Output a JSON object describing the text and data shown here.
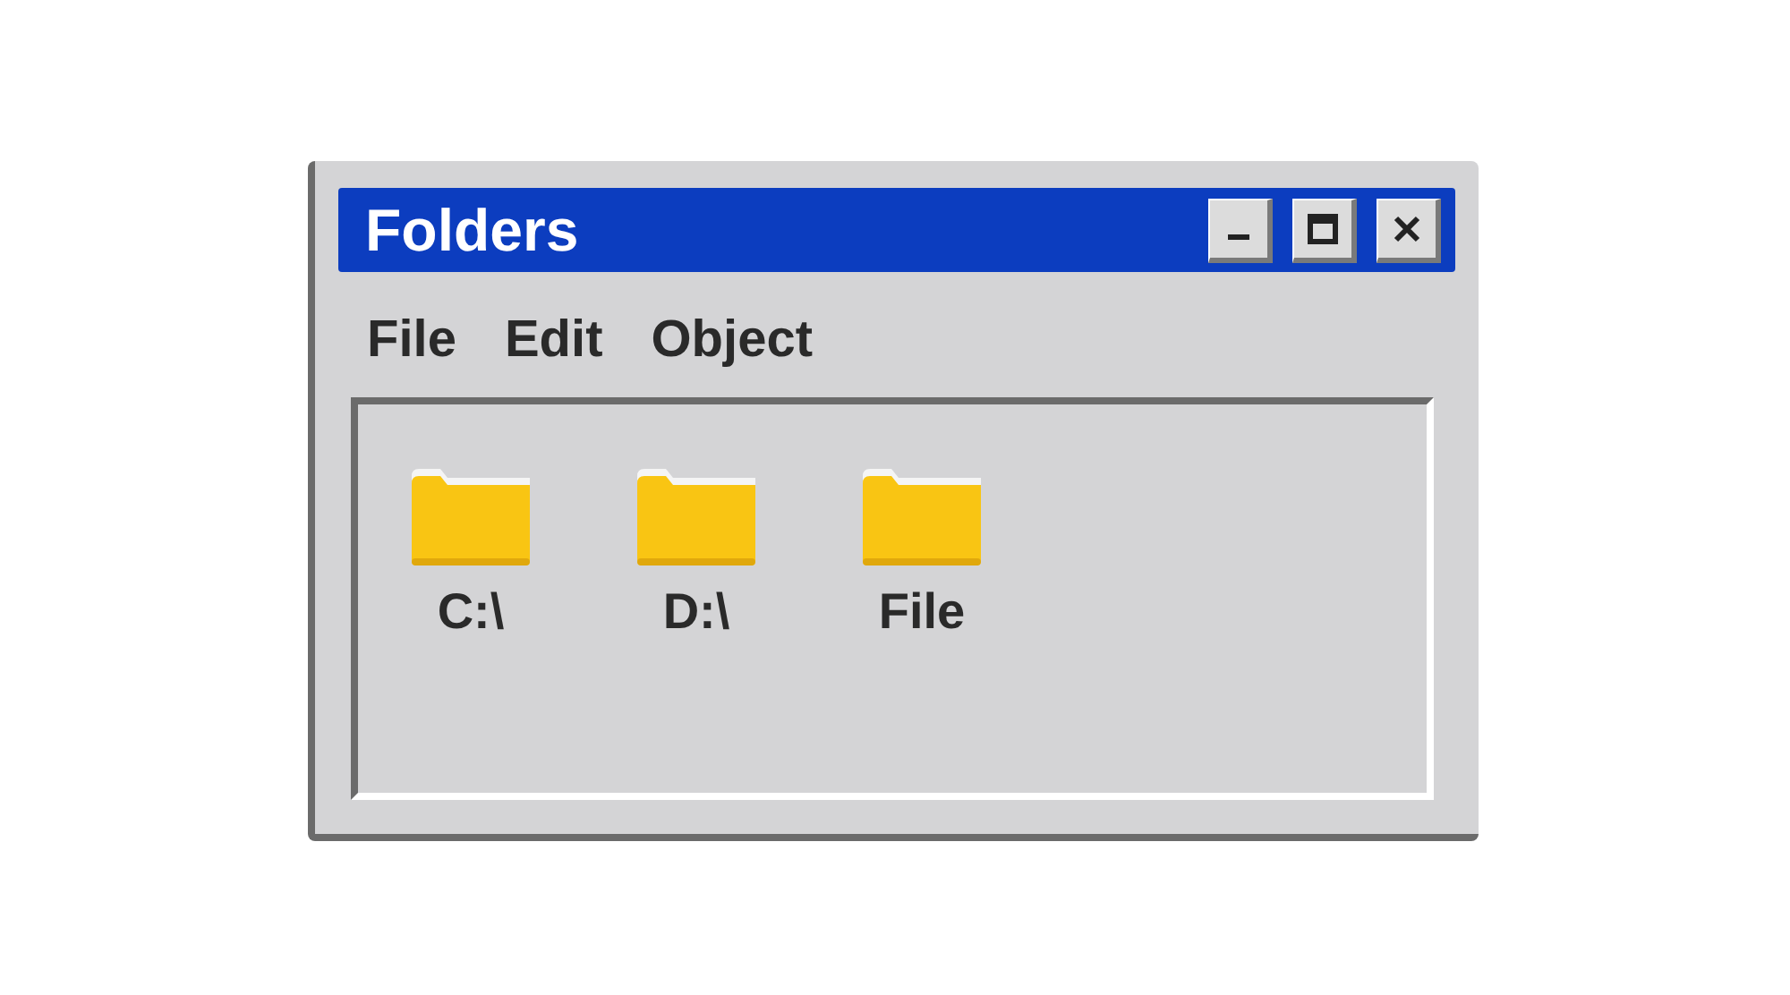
{
  "window": {
    "title": "Folders",
    "buttons": [
      {
        "kind": "minimize"
      },
      {
        "kind": "maximize"
      },
      {
        "kind": "close"
      }
    ]
  },
  "menu": [
    "File",
    "Edit",
    "Object"
  ],
  "items": [
    {
      "label": "C:\\"
    },
    {
      "label": "D:\\"
    },
    {
      "label": "File"
    }
  ]
}
